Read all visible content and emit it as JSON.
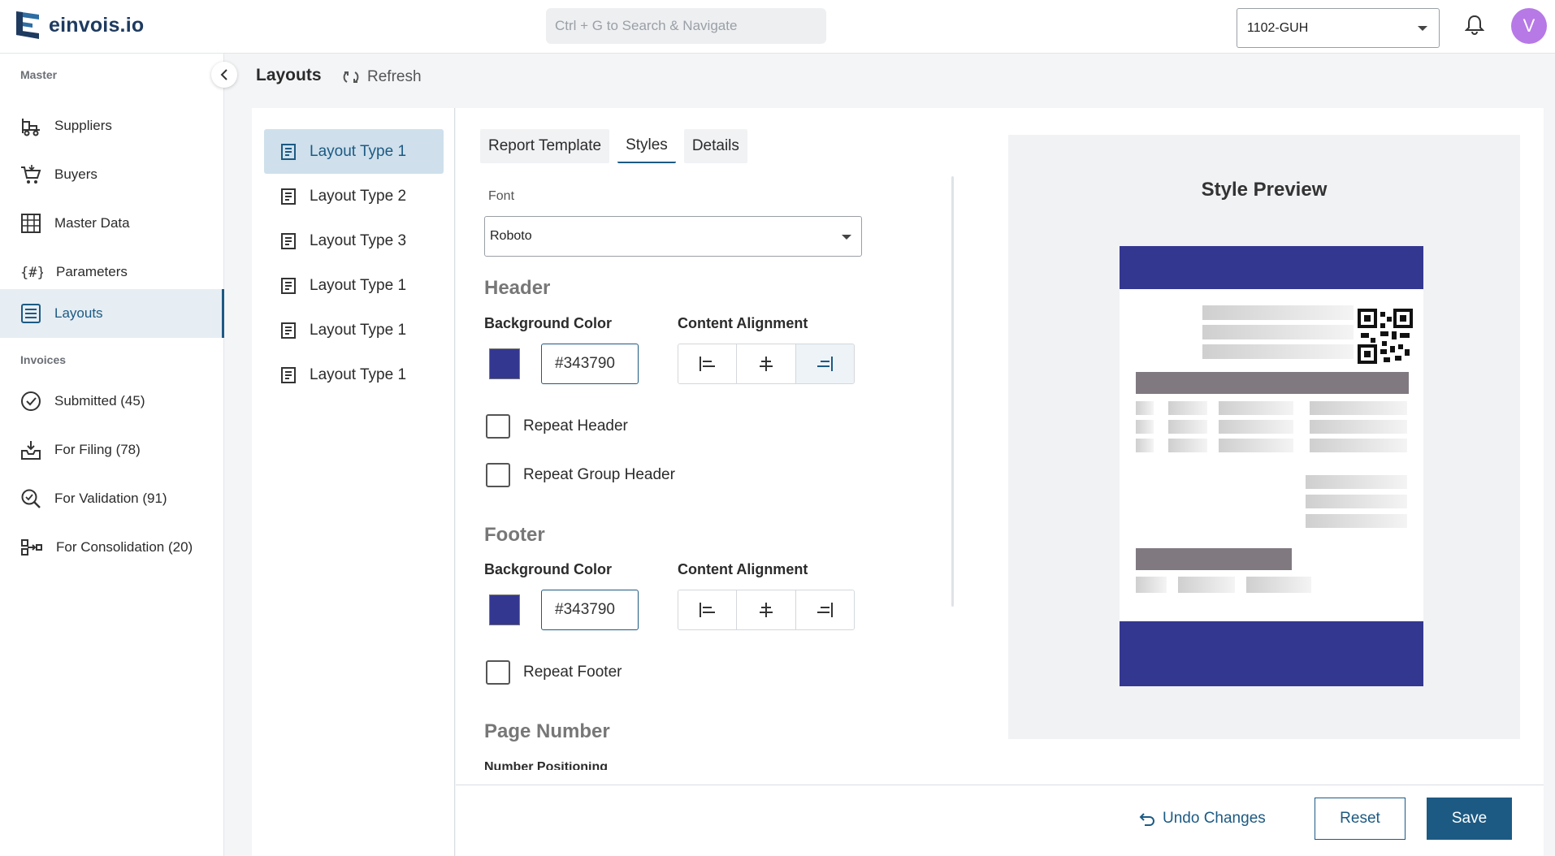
{
  "app": {
    "name": "einvois.io"
  },
  "search": {
    "placeholder": "Ctrl + G to Search & Navigate"
  },
  "company_selector": {
    "value": "1102-GUH"
  },
  "user": {
    "initial": "V",
    "avatar_color": "#b779e6"
  },
  "sidebar": {
    "master_title": "Master",
    "master_items": [
      {
        "label": "Suppliers",
        "icon": "suppliers-icon"
      },
      {
        "label": "Buyers",
        "icon": "cart-icon"
      },
      {
        "label": "Master Data",
        "icon": "master-data-icon"
      },
      {
        "label": "Parameters",
        "icon": "parameters-icon"
      },
      {
        "label": "Layouts",
        "icon": "layouts-icon",
        "active": true
      }
    ],
    "invoices_title": "Invoices",
    "invoice_items": [
      {
        "label": "Submitted (45)",
        "icon": "check-circle-icon"
      },
      {
        "label": "For Filing (78)",
        "icon": "inbox-icon"
      },
      {
        "label": "For Validation (91)",
        "icon": "search-check-icon"
      },
      {
        "label": "For Consolidation (20)",
        "icon": "consolidation-icon"
      }
    ]
  },
  "page": {
    "title": "Layouts",
    "refresh_label": "Refresh"
  },
  "layouts": [
    {
      "label": "Layout Type 1",
      "active": true
    },
    {
      "label": "Layout Type 2"
    },
    {
      "label": "Layout Type 3"
    },
    {
      "label": "Layout Type 1"
    },
    {
      "label": "Layout Type 1"
    },
    {
      "label": "Layout Type 1"
    }
  ],
  "tabs": [
    {
      "label": "Report Template"
    },
    {
      "label": "Styles",
      "active": true
    },
    {
      "label": "Details"
    }
  ],
  "styles": {
    "font_label": "Font",
    "font_value": "Roboto",
    "header": {
      "heading": "Header",
      "bg_label": "Background Color",
      "bg_value": "#343790",
      "align_label": "Content Alignment",
      "align_selected": "right",
      "repeat_header": "Repeat Header",
      "repeat_group_header": "Repeat Group Header"
    },
    "footer": {
      "heading": "Footer",
      "bg_label": "Background Color",
      "bg_value": "#343790",
      "align_label": "Content Alignment",
      "repeat_footer": "Repeat Footer"
    },
    "page_number": {
      "heading": "Page Number",
      "positioning_label": "Number Positioning"
    }
  },
  "preview": {
    "title": "Style Preview"
  },
  "actions": {
    "undo": "Undo Changes",
    "reset": "Reset",
    "save": "Save"
  },
  "colors": {
    "accent": "#1c5a83",
    "header_footer_bg": "#343790"
  }
}
